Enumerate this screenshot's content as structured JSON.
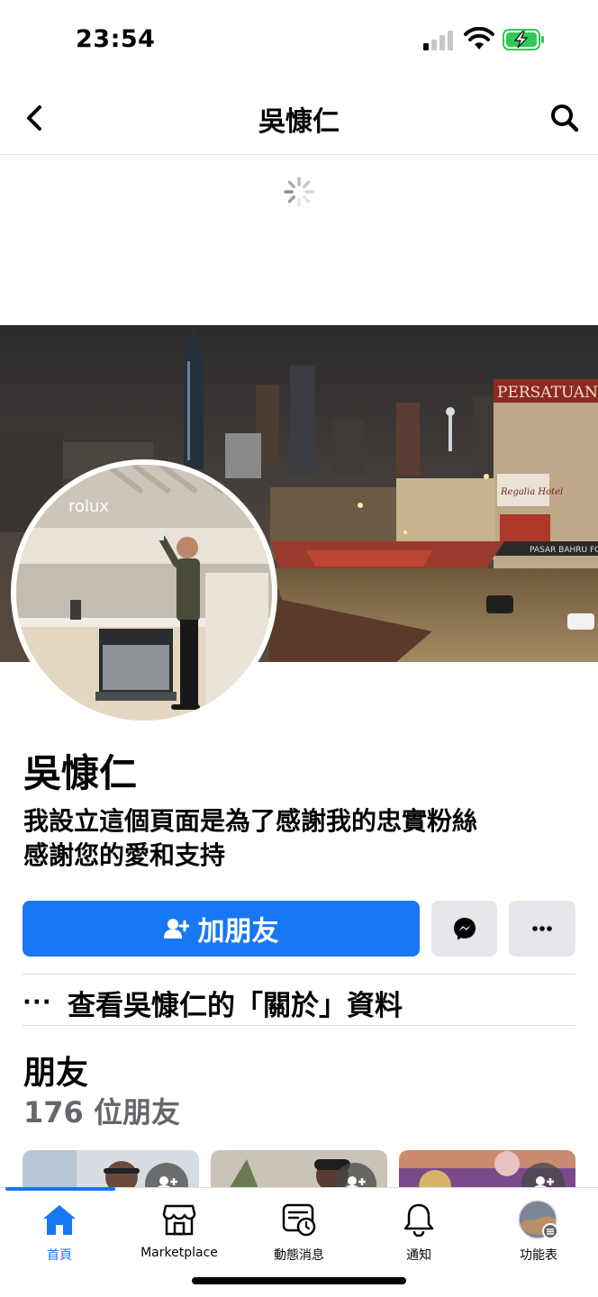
{
  "status_bar": {
    "time": "23:54",
    "signal_icon": "cellular-signal-icon",
    "wifi_icon": "wifi-icon",
    "battery_icon": "battery-charging-icon"
  },
  "header": {
    "title": "吳慷仁",
    "back_icon": "chevron-left-icon",
    "search_icon": "search-icon"
  },
  "profile": {
    "name": "吳慷仁",
    "bio_line1": "我設立這個頁面是為了感謝我的忠實粉絲",
    "bio_line2": "感謝您的愛和支持"
  },
  "cover": {
    "sign_persatuan": "PERSATUAN",
    "sign_hotel": "Regalia Hotel",
    "sign_market": "PASAR BAHRU FOO",
    "avatar_brand": "rolux"
  },
  "actions": {
    "add_friend_label": "加朋友",
    "add_friend_icon": "add-friend-icon",
    "messenger_icon": "messenger-icon",
    "more_icon": "more-dots-icon"
  },
  "about": {
    "dots": "···",
    "label": "查看吳慷仁的「關於」資料"
  },
  "friends": {
    "title": "朋友",
    "count": "176 位朋友"
  },
  "tabs": [
    {
      "label": "首頁",
      "icon": "home-icon",
      "active": true
    },
    {
      "label": "Marketplace",
      "icon": "marketplace-icon",
      "active": false
    },
    {
      "label": "動態消息",
      "icon": "feed-icon",
      "active": false
    },
    {
      "label": "通知",
      "icon": "bell-icon",
      "active": false
    },
    {
      "label": "功能表",
      "icon": "menu-avatar-icon",
      "active": false
    }
  ],
  "colors": {
    "primary": "#1877f2",
    "secondary_button": "#e4e6eb",
    "muted_text": "#65676b"
  }
}
